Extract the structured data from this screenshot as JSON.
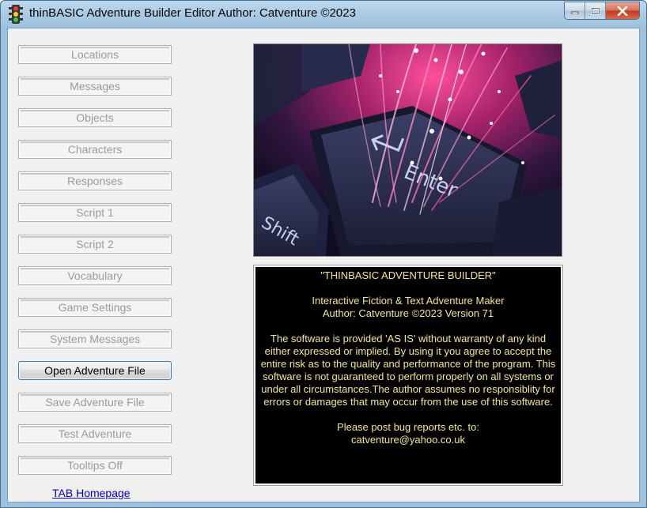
{
  "window": {
    "title": "thinBASIC Adventure Builder Editor  Author: Catventure ©2023",
    "icon": "traffic-light-icon",
    "caption_buttons": [
      "minimize-icon",
      "maximize-icon",
      "close-icon"
    ]
  },
  "sidebar": {
    "buttons": [
      {
        "label": "Locations",
        "enabled": false
      },
      {
        "label": "Messages",
        "enabled": false
      },
      {
        "label": "Objects",
        "enabled": false
      },
      {
        "label": "Characters",
        "enabled": false
      },
      {
        "label": "Responses",
        "enabled": false
      },
      {
        "label": "Script 1",
        "enabled": false
      },
      {
        "label": "Script 2",
        "enabled": false
      },
      {
        "label": "Vocabulary",
        "enabled": false
      },
      {
        "label": "Game Settings",
        "enabled": false
      },
      {
        "label": "System Messages",
        "enabled": false
      },
      {
        "label": "Open Adventure File",
        "enabled": true
      },
      {
        "label": "Save Adventure File",
        "enabled": false
      },
      {
        "label": "Test Adventure",
        "enabled": false
      },
      {
        "label": "Tooltips Off",
        "enabled": false
      }
    ],
    "homepage_link": "TAB Homepage"
  },
  "splash": {
    "image_keys": [
      "Enter",
      "Shift"
    ]
  },
  "info": {
    "title": "\"THINBASIC ADVENTURE BUILDER\"",
    "subtitle": "Interactive Fiction & Text Adventure Maker",
    "author_version": "Author: Catventure ©2023  Version 71",
    "disclaimer": "The software is provided 'AS IS' without warranty of any kind either expressed or implied. By using it you agree to accept the entire risk as to the quality and performance of the program. This software is not guaranteed to perform properly on all systems or under all circumstances.The author assumes no responsiblity for errors or damages that may occur from the use of this software.",
    "bug_report": "Please post bug reports etc. to:",
    "email": "catventure@yahoo.co.uk"
  },
  "colors": {
    "info_text": "#f3e88a",
    "info_background": "#000000",
    "link": "#0000cc",
    "active_button_border": "#3c7fb1"
  }
}
